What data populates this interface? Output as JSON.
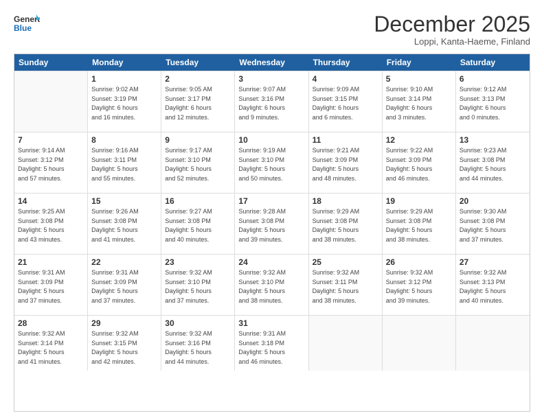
{
  "header": {
    "logo_line1": "General",
    "logo_line2": "Blue",
    "month": "December 2025",
    "location": "Loppi, Kanta-Haeme, Finland"
  },
  "weekdays": [
    "Sunday",
    "Monday",
    "Tuesday",
    "Wednesday",
    "Thursday",
    "Friday",
    "Saturday"
  ],
  "weeks": [
    [
      {
        "day": "",
        "info": ""
      },
      {
        "day": "1",
        "info": "Sunrise: 9:02 AM\nSunset: 3:19 PM\nDaylight: 6 hours\nand 16 minutes."
      },
      {
        "day": "2",
        "info": "Sunrise: 9:05 AM\nSunset: 3:17 PM\nDaylight: 6 hours\nand 12 minutes."
      },
      {
        "day": "3",
        "info": "Sunrise: 9:07 AM\nSunset: 3:16 PM\nDaylight: 6 hours\nand 9 minutes."
      },
      {
        "day": "4",
        "info": "Sunrise: 9:09 AM\nSunset: 3:15 PM\nDaylight: 6 hours\nand 6 minutes."
      },
      {
        "day": "5",
        "info": "Sunrise: 9:10 AM\nSunset: 3:14 PM\nDaylight: 6 hours\nand 3 minutes."
      },
      {
        "day": "6",
        "info": "Sunrise: 9:12 AM\nSunset: 3:13 PM\nDaylight: 6 hours\nand 0 minutes."
      }
    ],
    [
      {
        "day": "7",
        "info": "Sunrise: 9:14 AM\nSunset: 3:12 PM\nDaylight: 5 hours\nand 57 minutes."
      },
      {
        "day": "8",
        "info": "Sunrise: 9:16 AM\nSunset: 3:11 PM\nDaylight: 5 hours\nand 55 minutes."
      },
      {
        "day": "9",
        "info": "Sunrise: 9:17 AM\nSunset: 3:10 PM\nDaylight: 5 hours\nand 52 minutes."
      },
      {
        "day": "10",
        "info": "Sunrise: 9:19 AM\nSunset: 3:10 PM\nDaylight: 5 hours\nand 50 minutes."
      },
      {
        "day": "11",
        "info": "Sunrise: 9:21 AM\nSunset: 3:09 PM\nDaylight: 5 hours\nand 48 minutes."
      },
      {
        "day": "12",
        "info": "Sunrise: 9:22 AM\nSunset: 3:09 PM\nDaylight: 5 hours\nand 46 minutes."
      },
      {
        "day": "13",
        "info": "Sunrise: 9:23 AM\nSunset: 3:08 PM\nDaylight: 5 hours\nand 44 minutes."
      }
    ],
    [
      {
        "day": "14",
        "info": "Sunrise: 9:25 AM\nSunset: 3:08 PM\nDaylight: 5 hours\nand 43 minutes."
      },
      {
        "day": "15",
        "info": "Sunrise: 9:26 AM\nSunset: 3:08 PM\nDaylight: 5 hours\nand 41 minutes."
      },
      {
        "day": "16",
        "info": "Sunrise: 9:27 AM\nSunset: 3:08 PM\nDaylight: 5 hours\nand 40 minutes."
      },
      {
        "day": "17",
        "info": "Sunrise: 9:28 AM\nSunset: 3:08 PM\nDaylight: 5 hours\nand 39 minutes."
      },
      {
        "day": "18",
        "info": "Sunrise: 9:29 AM\nSunset: 3:08 PM\nDaylight: 5 hours\nand 38 minutes."
      },
      {
        "day": "19",
        "info": "Sunrise: 9:29 AM\nSunset: 3:08 PM\nDaylight: 5 hours\nand 38 minutes."
      },
      {
        "day": "20",
        "info": "Sunrise: 9:30 AM\nSunset: 3:08 PM\nDaylight: 5 hours\nand 37 minutes."
      }
    ],
    [
      {
        "day": "21",
        "info": "Sunrise: 9:31 AM\nSunset: 3:09 PM\nDaylight: 5 hours\nand 37 minutes."
      },
      {
        "day": "22",
        "info": "Sunrise: 9:31 AM\nSunset: 3:09 PM\nDaylight: 5 hours\nand 37 minutes."
      },
      {
        "day": "23",
        "info": "Sunrise: 9:32 AM\nSunset: 3:10 PM\nDaylight: 5 hours\nand 37 minutes."
      },
      {
        "day": "24",
        "info": "Sunrise: 9:32 AM\nSunset: 3:10 PM\nDaylight: 5 hours\nand 38 minutes."
      },
      {
        "day": "25",
        "info": "Sunrise: 9:32 AM\nSunset: 3:11 PM\nDaylight: 5 hours\nand 38 minutes."
      },
      {
        "day": "26",
        "info": "Sunrise: 9:32 AM\nSunset: 3:12 PM\nDaylight: 5 hours\nand 39 minutes."
      },
      {
        "day": "27",
        "info": "Sunrise: 9:32 AM\nSunset: 3:13 PM\nDaylight: 5 hours\nand 40 minutes."
      }
    ],
    [
      {
        "day": "28",
        "info": "Sunrise: 9:32 AM\nSunset: 3:14 PM\nDaylight: 5 hours\nand 41 minutes."
      },
      {
        "day": "29",
        "info": "Sunrise: 9:32 AM\nSunset: 3:15 PM\nDaylight: 5 hours\nand 42 minutes."
      },
      {
        "day": "30",
        "info": "Sunrise: 9:32 AM\nSunset: 3:16 PM\nDaylight: 5 hours\nand 44 minutes."
      },
      {
        "day": "31",
        "info": "Sunrise: 9:31 AM\nSunset: 3:18 PM\nDaylight: 5 hours\nand 46 minutes."
      },
      {
        "day": "",
        "info": ""
      },
      {
        "day": "",
        "info": ""
      },
      {
        "day": "",
        "info": ""
      }
    ]
  ]
}
